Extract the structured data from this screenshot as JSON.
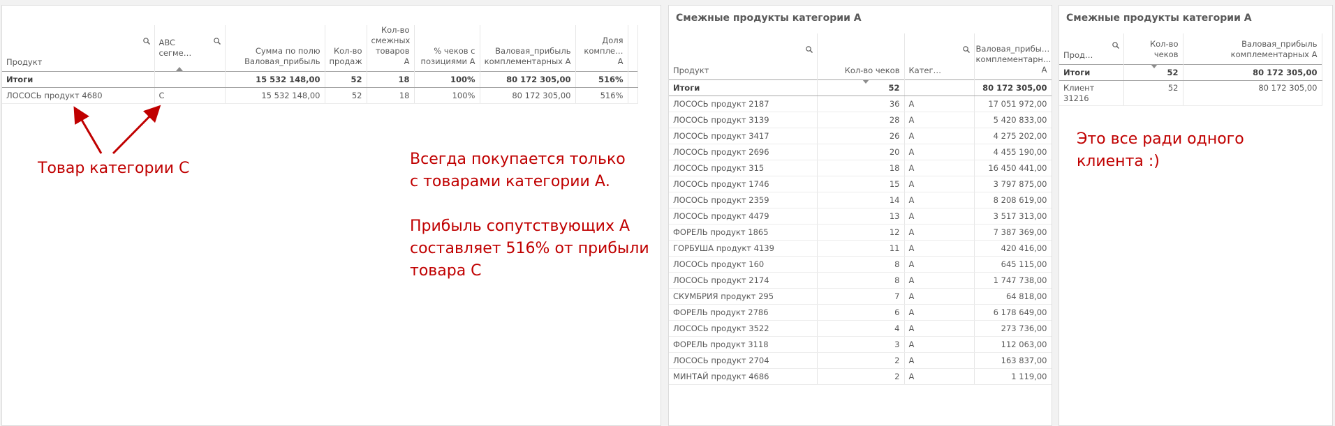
{
  "panel1": {
    "columns": [
      "Продукт",
      "ABC сегме…",
      "Сумма по полю Валовая_прибыль",
      "Кол-во продаж",
      "Кол-во смежных товаров А",
      "% чеков с позициями А",
      "Валовая_прибыль комплементарных А",
      "Доля компле… А"
    ],
    "totals": [
      "Итоги",
      "",
      "15 532 148,00",
      "52",
      "18",
      "100%",
      "80 172 305,00",
      "516%"
    ],
    "row": [
      "ЛОСОСЬ продукт 4680",
      "C",
      "15 532 148,00",
      "52",
      "18",
      "100%",
      "80 172 305,00",
      "516%"
    ]
  },
  "annotations": {
    "arrow_label": "Товар категории С",
    "main_lines": [
      "Всегда покупается только",
      "с товарами категории А.",
      "",
      "Прибыль сопутствующих А",
      "составляет 516% от прибыли",
      "товара С"
    ],
    "client_lines": [
      "Это все ради одного",
      "клиента :)"
    ]
  },
  "panel2": {
    "title": "Смежные продукты категории А",
    "columns": [
      "Продукт",
      "Кол-во чеков",
      "Катег…",
      "Валовая_прибы… комплементарн… А"
    ],
    "totals": [
      "Итоги",
      "52",
      "",
      "80 172 305,00"
    ],
    "rows": [
      [
        "ЛОСОСЬ продукт 2187",
        "36",
        "A",
        "17 051 972,00"
      ],
      [
        "ЛОСОСЬ продукт 3139",
        "28",
        "A",
        "5 420 833,00"
      ],
      [
        "ЛОСОСЬ продукт 3417",
        "26",
        "A",
        "4 275 202,00"
      ],
      [
        "ЛОСОСЬ продукт 2696",
        "20",
        "A",
        "4 455 190,00"
      ],
      [
        "ЛОСОСЬ продукт 315",
        "18",
        "A",
        "16 450 441,00"
      ],
      [
        "ЛОСОСЬ продукт 1746",
        "15",
        "A",
        "3 797 875,00"
      ],
      [
        "ЛОСОСЬ продукт 2359",
        "14",
        "A",
        "8 208 619,00"
      ],
      [
        "ЛОСОСЬ продукт 4479",
        "13",
        "A",
        "3 517 313,00"
      ],
      [
        "ФОРЕЛЬ продукт 1865",
        "12",
        "A",
        "7 387 369,00"
      ],
      [
        "ГОРБУША продукт 4139",
        "11",
        "A",
        "420 416,00"
      ],
      [
        "ЛОСОСЬ продукт 160",
        "8",
        "A",
        "645 115,00"
      ],
      [
        "ЛОСОСЬ продукт 2174",
        "8",
        "A",
        "1 747 738,00"
      ],
      [
        "СКУМБРИЯ продукт 295",
        "7",
        "A",
        "64 818,00"
      ],
      [
        "ФОРЕЛЬ продукт 2786",
        "6",
        "A",
        "6 178 649,00"
      ],
      [
        "ЛОСОСЬ продукт 3522",
        "4",
        "A",
        "273 736,00"
      ],
      [
        "ФОРЕЛЬ продукт 3118",
        "3",
        "A",
        "112 063,00"
      ],
      [
        "ЛОСОСЬ продукт 2704",
        "2",
        "A",
        "163 837,00"
      ],
      [
        "МИНТАЙ продукт 4686",
        "2",
        "A",
        "1 119,00"
      ]
    ]
  },
  "panel3": {
    "title": "Смежные продукты категории А",
    "columns": [
      "Прод…",
      "Кол-во чеков",
      "Валовая_прибыль комплементарных А"
    ],
    "totals": [
      "Итоги",
      "52",
      "80 172 305,00"
    ],
    "row": [
      "Клиент 31216",
      "52",
      "80 172 305,00"
    ]
  },
  "colors": {
    "annotation": "#c00000",
    "background": "#f2f2f2",
    "panel": "#ffffff"
  }
}
